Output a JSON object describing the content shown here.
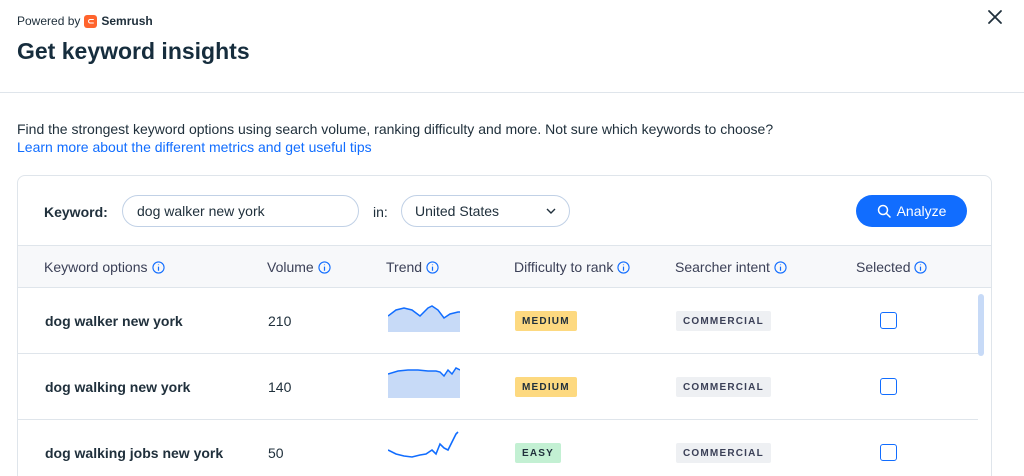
{
  "header": {
    "powered_by": "Powered by",
    "brand": "Semrush",
    "brand_color": "#ff642d",
    "title": "Get keyword insights",
    "close_icon": "close-icon"
  },
  "intro": {
    "description": "Find the strongest keyword options using search volume, ranking difficulty and more. Not sure which keywords to choose?",
    "link": "Learn more about the different metrics and get useful tips"
  },
  "search": {
    "keyword_label": "Keyword:",
    "keyword_value": "dog walker new york",
    "in_label": "in:",
    "country_value": "United States",
    "analyze_label": "Analyze"
  },
  "table": {
    "columns": [
      "Keyword options",
      "Volume",
      "Trend",
      "Difficulty to rank",
      "Searcher intent",
      "Selected"
    ],
    "rows": [
      {
        "keyword": "dog walker new york",
        "volume": "210",
        "difficulty": "MEDIUM",
        "intent": "COMMERCIAL",
        "selected": false
      },
      {
        "keyword": "dog walking new york",
        "volume": "140",
        "difficulty": "MEDIUM",
        "intent": "COMMERCIAL",
        "selected": false
      },
      {
        "keyword": "dog walking jobs new york",
        "volume": "50",
        "difficulty": "EASY",
        "intent": "COMMERCIAL",
        "selected": false
      }
    ]
  },
  "colors": {
    "accent": "#116dff",
    "medium_badge": "#fdd980",
    "easy_badge": "#c3f0d3",
    "trend_line": "#116dff",
    "trend_fill": "#c7daf7"
  }
}
